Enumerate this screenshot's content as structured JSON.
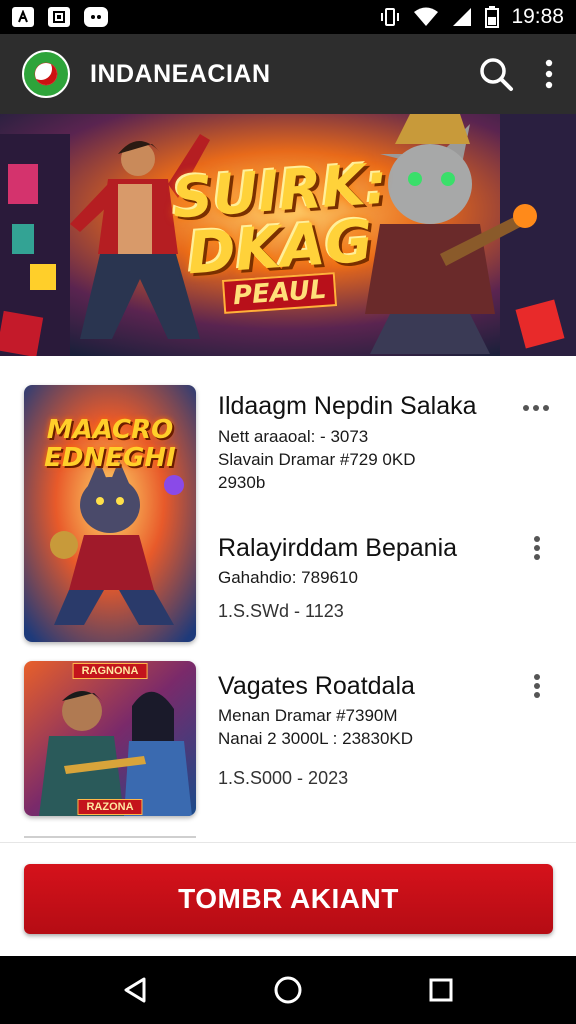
{
  "status_bar": {
    "time": "19:88",
    "left_icons": [
      "notification-a-icon",
      "notification-b-icon",
      "discord-icon"
    ],
    "right_icons": [
      "vibrate-icon",
      "wifi-icon",
      "signal-icon",
      "battery-icon"
    ]
  },
  "app_bar": {
    "title": "INDANEACIAN",
    "actions": [
      "search-icon",
      "more-vert-icon"
    ]
  },
  "hero": {
    "line1": "SUIRK:",
    "line2": "DKAG",
    "line3": "PEAUL"
  },
  "items": [
    {
      "thumb_title_1": "MAACRO",
      "thumb_title_2": "EDNEGHI",
      "title": "Ildaagm Nepdin Salaka",
      "line1": "Nett araaoal: - 3073",
      "line2": "Slavain Dramar #729 0KD",
      "line3": "2930b",
      "menu_icon": "more-horiz-icon"
    },
    {
      "title": "Ralayirddam Bepania",
      "line1": "Gahahdio: 789610",
      "line2": "1.S.SWd - 1123",
      "menu_icon": "more-vert-icon"
    },
    {
      "thumb_badge": "RAGNONA",
      "thumb_badge_bottom": "RAZONA",
      "title": "Vagates Roatdala",
      "line1": "Menan Dramar #7390M",
      "line2": "Nanai 2 3000L : 23830KD",
      "line3": "1.S.S000 - 2023",
      "menu_icon": "more-vert-icon"
    }
  ],
  "cta": {
    "label": "TOMBR AKIANT"
  },
  "nav": {
    "icons": [
      "back-icon",
      "home-icon",
      "recents-icon"
    ]
  },
  "colors": {
    "accent": "#c8101a",
    "appbar": "#2d2d2d",
    "hero_text": "#ffd23a"
  }
}
